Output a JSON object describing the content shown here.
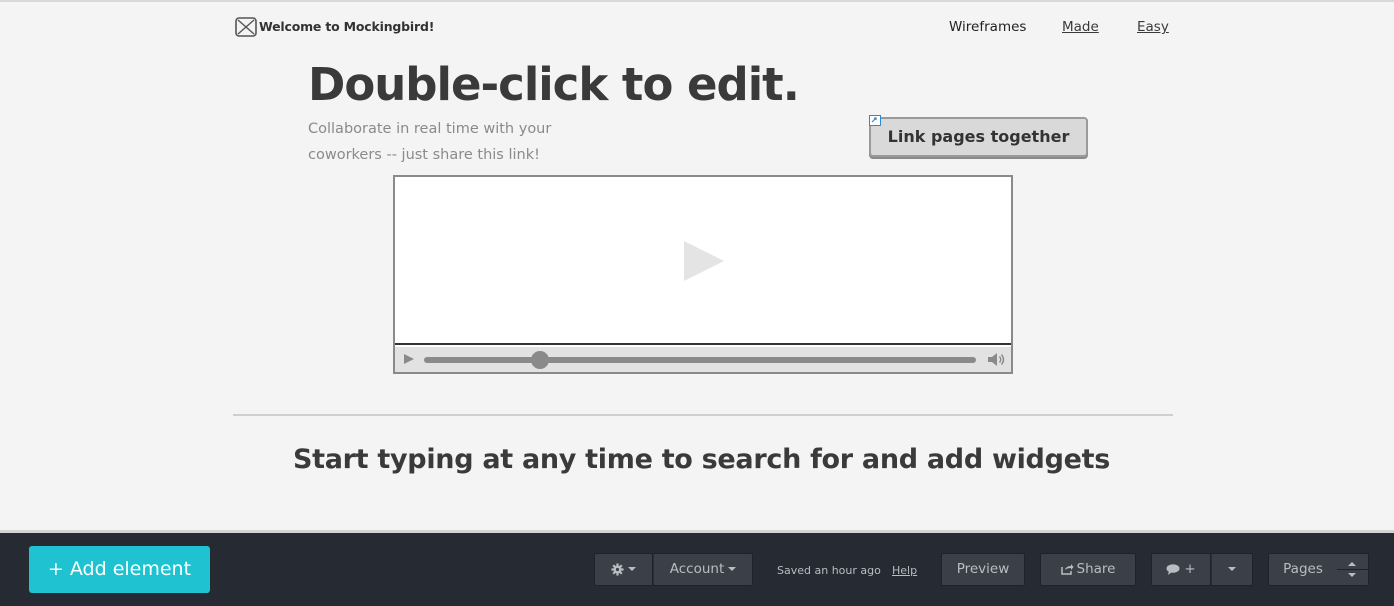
{
  "header": {
    "title": "Welcome to Mockingbird!",
    "nav": [
      "Wireframes",
      "Made",
      "Easy"
    ]
  },
  "hero": {
    "headline": "Double-click to edit.",
    "subtext": "Collaborate in real time with your coworkers -- just share this link!",
    "link_button": "Link pages together"
  },
  "video": {
    "progress": 0.21
  },
  "hint": "Start typing at any time to search for and add widgets",
  "toolbar": {
    "add_element": "+ Add element",
    "account": "Account",
    "saved_status": "Saved an hour ago",
    "help": "Help",
    "preview": "Preview",
    "share": "Share",
    "comment_add": "+",
    "pages": "Pages"
  },
  "colors": {
    "accent": "#1fc2d0",
    "toolbar_bg": "#262b33",
    "canvas_bg": "#f4f4f4"
  },
  "icons": [
    "broken-image-icon",
    "link-icon",
    "play-icon",
    "volume-icon",
    "gear-icon",
    "share-icon",
    "comment-icon",
    "chevron-down-icon"
  ]
}
